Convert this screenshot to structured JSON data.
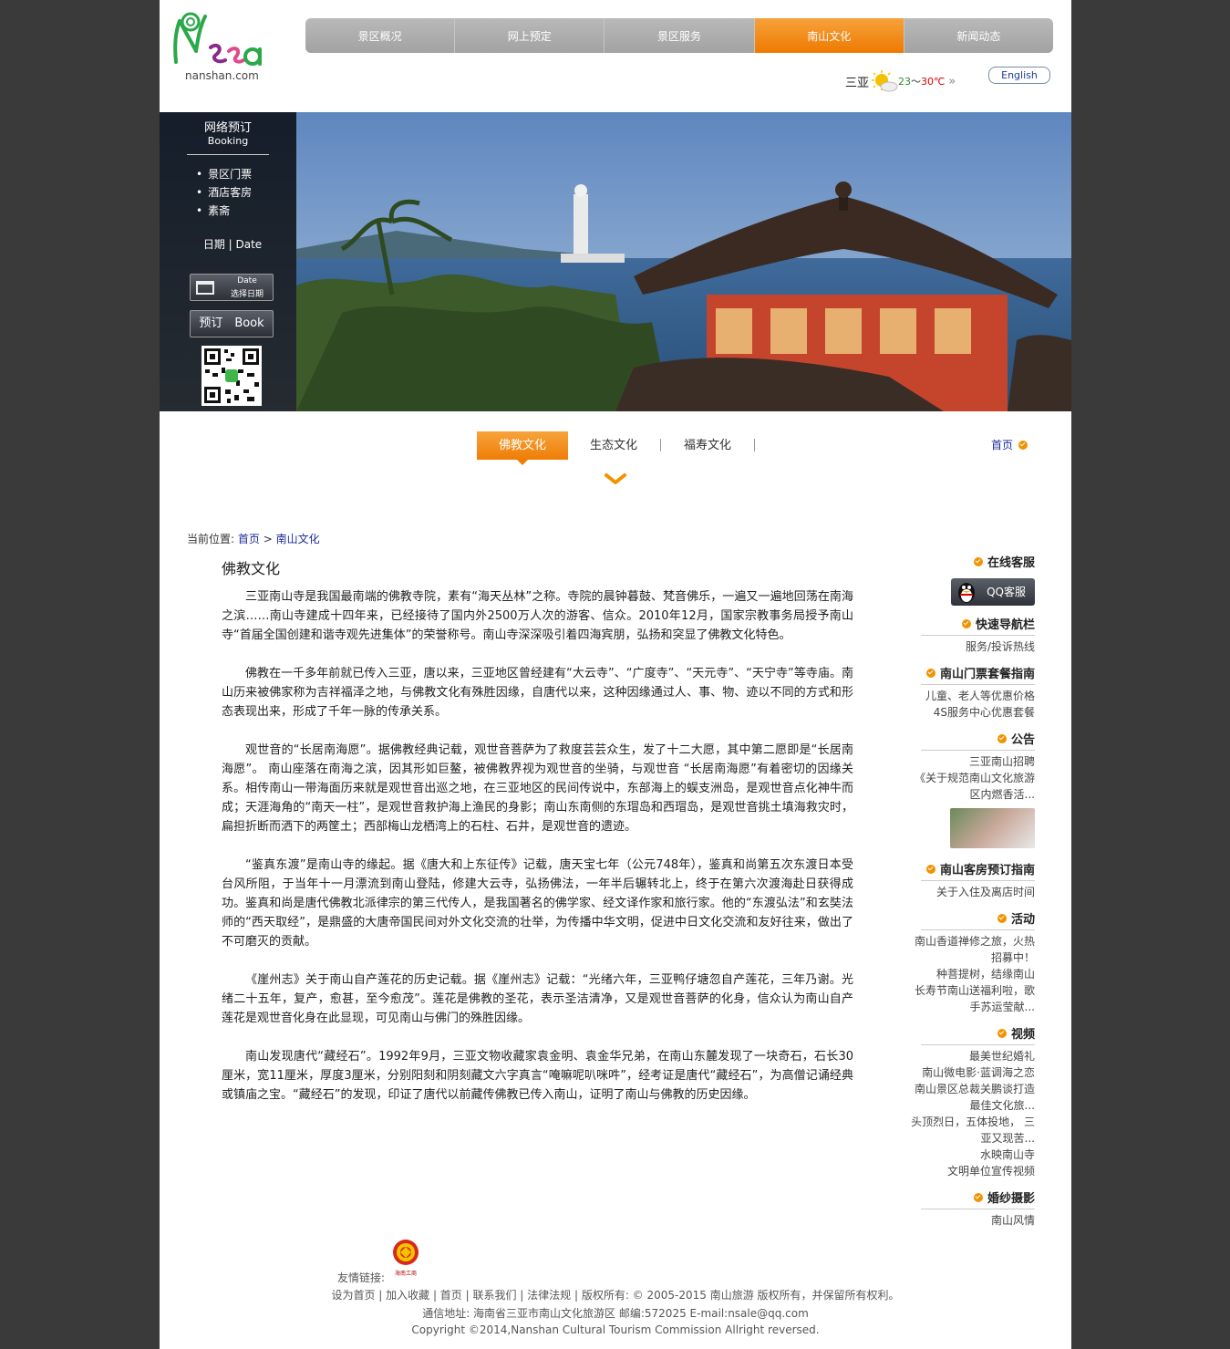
{
  "header": {
    "logo_text": "nanshan.com",
    "nav": [
      "景区概况",
      "网上预定",
      "景区服务",
      "南山文化",
      "新闻动态"
    ],
    "nav_active_index": 3,
    "weather": {
      "city": "三亚",
      "low": "23",
      "tilde": "～",
      "high": "30℃",
      "more": "»"
    },
    "lang_button": "English"
  },
  "booking": {
    "title": "网络预订",
    "subtitle": "Booking",
    "items": [
      "景区门票",
      "酒店客房",
      "素斋"
    ],
    "date_label": "日期 | Date",
    "date_button_line1": "Date",
    "date_button_line2": "选择日期",
    "book_button": "预订　Book"
  },
  "subnav": {
    "tabs": [
      "佛教文化",
      "生态文化",
      "福寿文化"
    ],
    "active_index": 0,
    "home_link": "首页"
  },
  "breadcrumb": {
    "label": "当前位置:",
    "home": "首页",
    "sep": ">",
    "current": "南山文化"
  },
  "article": {
    "title": "佛教文化",
    "paragraphs": [
      "三亚南山寺是我国最南端的佛教寺院，素有“海天丛林”之称。寺院的晨钟暮鼓、梵音佛乐，一遍又一遍地回荡在南海之滨……南山寺建成十四年来，已经接待了国内外2500万人次的游客、信众。2010年12月，国家宗教事务局授予南山寺“首届全国创建和谐寺观先进集体”的荣誉称号。南山寺深深吸引着四海宾朋，弘扬和突显了佛教文化特色。",
      "佛教在一千多年前就已传入三亚，唐以来，三亚地区曾经建有“大云寺”、“广度寺”、“天元寺”、“天宁寺”等寺庙。南山历来被佛家称为吉祥福泽之地，与佛教文化有殊胜因缘，自唐代以来，这种因缘通过人、事、物、迹以不同的方式和形态表现出来，形成了千年一脉的传承关系。",
      "观世音的“长居南海愿”。据佛教经典记载，观世音菩萨为了救度芸芸众生，发了十二大愿，其中第二愿即是“长居南海愿”。 南山座落在南海之滨，因其形如巨鳌，被佛教界视为观世音的坐骑，与观世音 “长居南海愿”有着密切的因缘关系。相传南山一带海面历来就是观世音出巡之地，在三亚地区的民间传说中，东部海上的蜈支洲岛，是观世音点化神牛而成；天涯海角的“南天一柱”，是观世音救护海上渔民的身影；南山东南侧的东瑁岛和西瑁岛，是观世音挑土填海救灾时，扁担折断而洒下的两筐土；西部梅山龙栖湾上的石柱、石井，是观世音的遗迹。",
      "“鉴真东渡”是南山寺的缘起。据《唐大和上东征传》记载，唐天宝七年（公元748年），鉴真和尚第五次东渡日本受台风所阻，于当年十一月漂流到南山登陆，修建大云寺，弘扬佛法，一年半后辗转北上，终于在第六次渡海赴日获得成功。鉴真和尚是唐代佛教北派律宗的第三代传人，是我国著名的佛学家、经文译作家和旅行家。他的“东渡弘法”和玄奘法师的“西天取经”，是鼎盛的大唐帝国民间对外文化交流的壮举，为传播中华文明，促进中日文化交流和友好往来，做出了不可磨灭的贡献。",
      "《崖州志》关于南山自产莲花的历史记载。据《崖州志》记载：“光绪六年，三亚鸭仔塘忽自产莲花，三年乃谢。光绪二十五年，复产，愈甚，至今愈茂”。莲花是佛教的圣花，表示圣洁清净，又是观世音菩萨的化身，信众认为南山自产莲花是观世音化身在此显现，可见南山与佛门的殊胜因缘。",
      "南山发现唐代“藏经石”。1992年9月，三亚文物收藏家袁金明、袁金华兄弟，在南山东麓发现了一块奇石，石长30厘米，宽11厘米，厚度3厘米，分别阳刻和阴刻藏文六字真言“唵嘛呢叭咪吽”，经考证是唐代“藏经石”，为高僧记诵经典或镇庙之宝。“藏经石”的发现，印证了唐代以前藏传佛教已传入南山，证明了南山与佛教的历史因缘。"
    ]
  },
  "sidebar": {
    "online": {
      "title": "在线客服",
      "qq_label": "QQ客服"
    },
    "sections": [
      {
        "title": "快速导航栏",
        "items": [
          "服务/投诉热线"
        ]
      },
      {
        "title": "南山门票套餐指南",
        "items": [
          "儿童、老人等优惠价格",
          "4S服务中心优惠套餐"
        ]
      },
      {
        "title": "公告",
        "items": [
          "三亚南山招聘",
          "《关于规范南山文化旅游",
          "区内燃香活..."
        ]
      },
      {
        "title": "南山客房预订指南",
        "items": [
          "关于入住及离店时间"
        ]
      },
      {
        "title": "活动",
        "items": [
          "南山香道禅修之旅，火热",
          "招募中！",
          "种菩提树，结缘南山",
          "长寿节南山送福利啦，歌",
          "手苏运莹献..."
        ]
      },
      {
        "title": "视频",
        "items": [
          "最美世纪婚礼",
          "南山微电影·蓝调海之恋",
          "南山景区总裁关鹏谈打造",
          "最佳文化旅...",
          "头顶烈日，五体投地， 三",
          "亚又现苦...",
          "水映南山寺",
          "文明单位宣传视频"
        ]
      },
      {
        "title": "婚纱摄影",
        "items": [
          "南山风情"
        ]
      }
    ]
  },
  "footer": {
    "friend_label": "友情链接:",
    "badge_caption": "海南工商",
    "links": "设为首页 | 加入收藏 | 首页 | 联系我们 | 法律法规 | 版权所有: © 2005-2015 南山旅游 版权所有，并保留所有权利。",
    "address": "通信地址: 海南省三亚市南山文化旅游区 邮编:572025 E-mail:nsale@qq.com",
    "copyright": "Copyright ©2014,Nanshan Cultural Tourism Commission Allright reversed."
  },
  "colors": {
    "accent": "#ef7d05",
    "nav_gray": "#a8a8a8",
    "link_blue": "#1a2a9a",
    "page_bg": "#3a3a3a"
  }
}
